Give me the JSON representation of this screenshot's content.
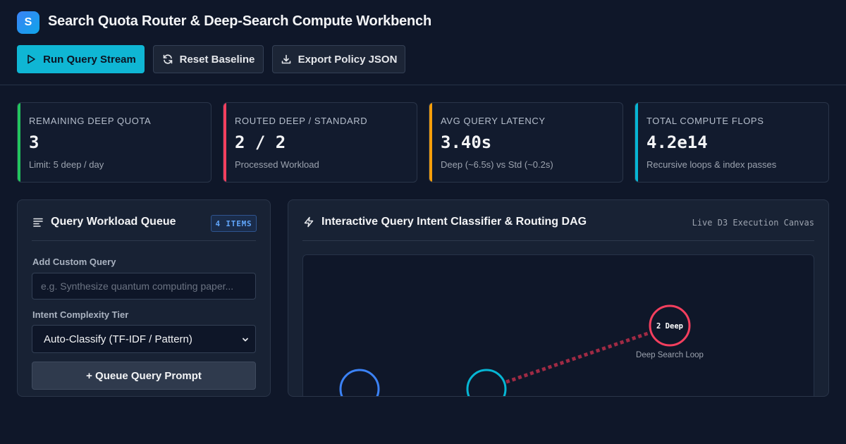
{
  "app": {
    "logo_letter": "S",
    "title": "Search Quota Router & Deep-Search Compute Workbench"
  },
  "toolbar": {
    "run_label": "Run Query Stream",
    "reset_label": "Reset Baseline",
    "export_label": "Export Policy JSON"
  },
  "stats": [
    {
      "label": "REMAINING DEEP QUOTA",
      "value": "3",
      "sub": "Limit: 5 deep / day",
      "accent": "#22c55e"
    },
    {
      "label": "ROUTED DEEP / STANDARD",
      "value": "2 / 2",
      "sub": "Processed Workload",
      "accent": "#f43f5e"
    },
    {
      "label": "AVG QUERY LATENCY",
      "value": "3.40s",
      "sub": "Deep (~6.5s) vs Std (~0.2s)",
      "accent": "#f59e0b"
    },
    {
      "label": "TOTAL COMPUTE FLOPS",
      "value": "4.2e14",
      "sub": "Recursive loops & index passes",
      "accent": "#06b6d4"
    }
  ],
  "queue_panel": {
    "title": "Query Workload Queue",
    "badge": "4 ITEMS",
    "add_label": "Add Custom Query",
    "add_placeholder": "e.g. Synthesize quantum computing paper...",
    "tier_label": "Intent Complexity Tier",
    "tier_selected": "Auto-Classify (TF-IDF / Pattern)",
    "queue_button": "+ Queue Query Prompt"
  },
  "dag_panel": {
    "title": "Interactive Query Intent Classifier & Routing DAG",
    "canvas_tag": "Live D3 Execution Canvas",
    "deep_node_label": "2 Deep",
    "deep_node_caption": "Deep Search Loop"
  },
  "colors": {
    "deep": "#f43f5e",
    "standard": "#3b82f6",
    "classifier": "#06b6d4",
    "deep_edge": "#9f2a44"
  },
  "icons": {
    "run": "play-icon",
    "reset": "refresh-icon",
    "export": "download-icon",
    "queue": "list-icon",
    "dag": "lightning-icon"
  }
}
